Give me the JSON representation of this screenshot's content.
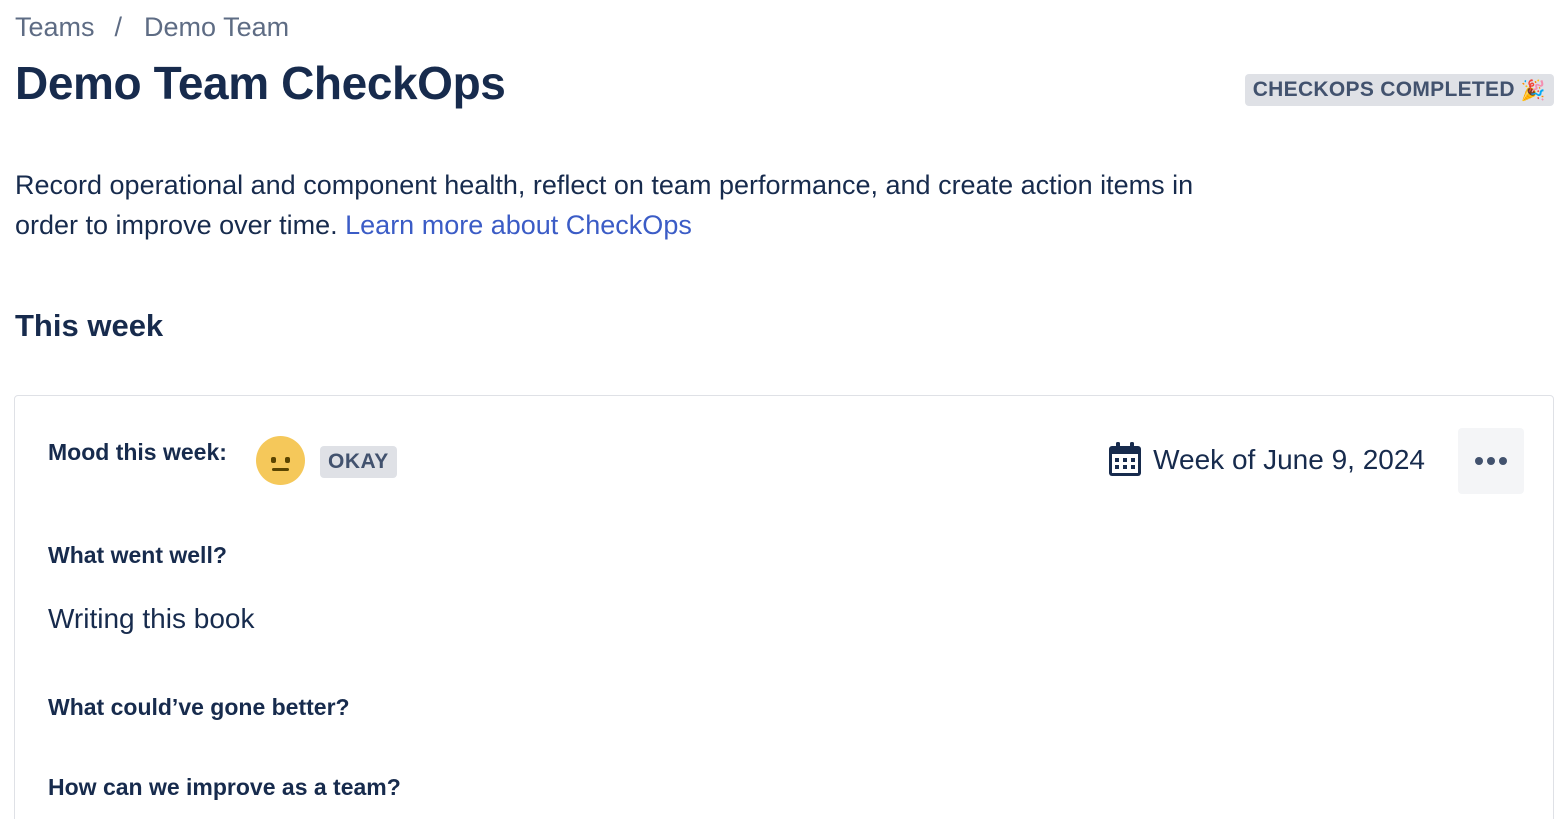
{
  "breadcrumb": {
    "items": [
      "Teams",
      "Demo Team"
    ],
    "separator": "/"
  },
  "header": {
    "title": "Demo Team CheckOps",
    "status_badge": "CHECKOPS COMPLETED",
    "status_badge_emoji": "🎉"
  },
  "description": {
    "text": "Record operational and component health, reflect on team performance, and create action items in order to improve over time.",
    "link_text": "Learn more about CheckOps"
  },
  "section": {
    "title": "This week"
  },
  "card": {
    "mood_label": "Mood this week:",
    "mood_icon": "neutral-face-icon",
    "mood_value": "OKAY",
    "week_label": "Week of June 9, 2024",
    "more_icon": "more-horizontal-icon",
    "questions": [
      {
        "label": "What went well?",
        "answer": "Writing this book"
      },
      {
        "label": "What could’ve gone better?",
        "answer": ""
      },
      {
        "label": "How can we improve as a team?",
        "answer": ""
      }
    ]
  },
  "colors": {
    "text": "#172b4d",
    "subtle_text": "#5e6c84",
    "link": "#3b5cc6",
    "lozenge_bg": "#dfe1e6",
    "mood_face": "#f5c85a"
  }
}
